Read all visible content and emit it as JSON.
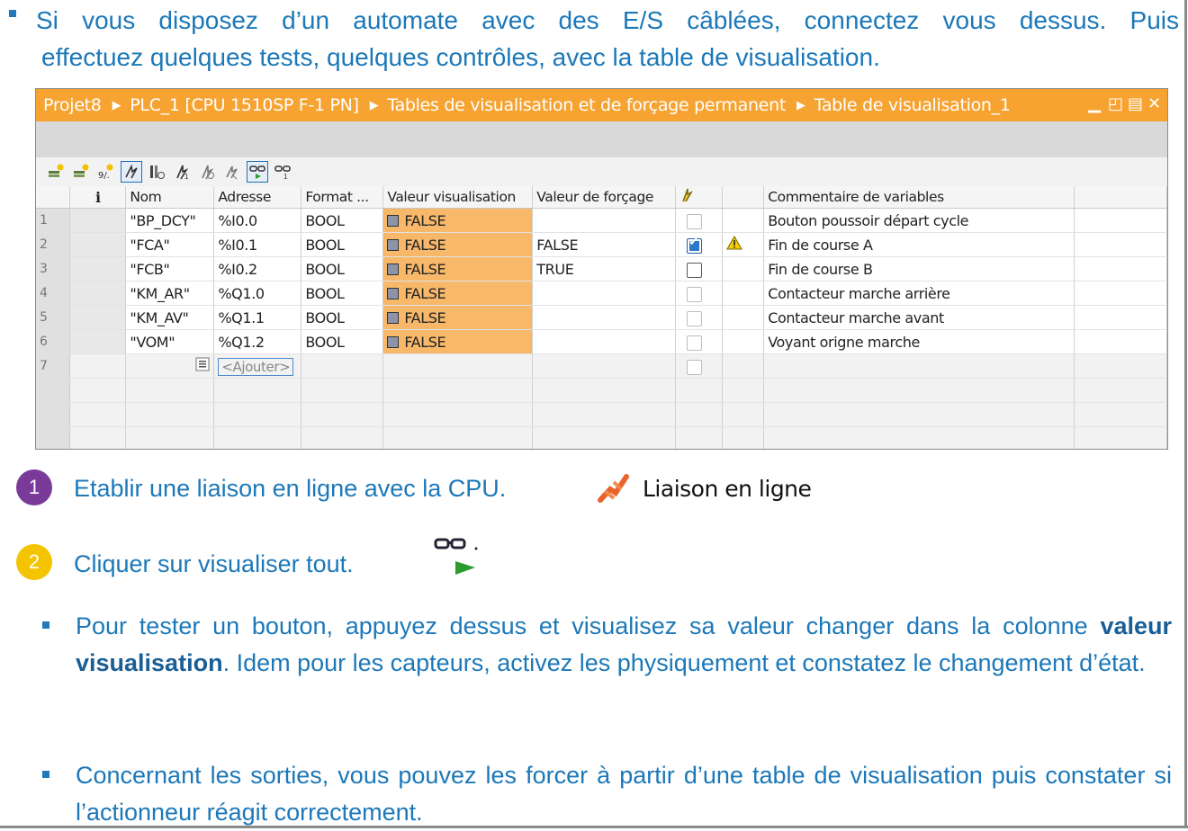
{
  "intro": {
    "line1": "Si vous disposez d’un automate avec des E/S câblées, connectez vous dessus. Puis",
    "line2": "effectuez quelques tests, quelques contrôles, avec la table de visualisation."
  },
  "window": {
    "breadcrumb": [
      "Projet8",
      "PLC_1 [CPU 1510SP F-1 PN]",
      "Tables de visualisation et de forçage permanent",
      "Table de visualisation_1"
    ],
    "title_bar_color": "#f7a331",
    "columns": [
      "",
      "i",
      "Nom",
      "Adresse",
      "Format ...",
      "Valeur visualisation",
      "Valeur de forçage",
      "",
      "",
      "Commentaire de variables"
    ],
    "rows": [
      {
        "num": "1",
        "nom": "\"BP_DCY\"",
        "adresse": "%I0.0",
        "format": "BOOL",
        "valeur": "FALSE",
        "forcage": "",
        "checked": false,
        "dark": false,
        "warn": false,
        "comment": "Bouton poussoir départ cycle"
      },
      {
        "num": "2",
        "nom": "\"FCA\"",
        "adresse": "%I0.1",
        "format": "BOOL",
        "valeur": "FALSE",
        "forcage": "FALSE",
        "checked": true,
        "dark": false,
        "warn": true,
        "comment": "Fin de course A"
      },
      {
        "num": "3",
        "nom": "\"FCB\"",
        "adresse": "%I0.2",
        "format": "BOOL",
        "valeur": "FALSE",
        "forcage": "TRUE",
        "checked": false,
        "dark": true,
        "warn": false,
        "comment": "Fin de course B"
      },
      {
        "num": "4",
        "nom": "\"KM_AR\"",
        "adresse": "%Q1.0",
        "format": "BOOL",
        "valeur": "FALSE",
        "forcage": "",
        "checked": false,
        "dark": false,
        "warn": false,
        "comment": "Contacteur marche arrière"
      },
      {
        "num": "5",
        "nom": "\"KM_AV\"",
        "adresse": "%Q1.1",
        "format": "BOOL",
        "valeur": "FALSE",
        "forcage": "",
        "checked": false,
        "dark": false,
        "warn": false,
        "comment": "Contacteur marche avant"
      },
      {
        "num": "6",
        "nom": "\"VOM\"",
        "adresse": "%Q1.2",
        "format": "BOOL",
        "valeur": "FALSE",
        "forcage": "",
        "checked": false,
        "dark": false,
        "warn": false,
        "comment": "Voyant origne marche"
      }
    ],
    "add_row": {
      "num": "7",
      "placeholder": "<Ajouter>"
    }
  },
  "steps": {
    "step1_num": "1",
    "step1_text": "Etablir une liaison en ligne avec la CPU.",
    "step1_button": "Liaison en ligne",
    "step2_num": "2",
    "step2_text": "Cliquer sur visualiser tout.",
    "step1_color": "#7a3a9a",
    "step2_color": "#f5c400"
  },
  "bullets": {
    "b1_pre": "Pour tester un bouton, appuyez dessus et visualisez sa valeur changer dans la colonne ",
    "b1_bold": "valeur visualisation",
    "b1_post": ". Idem pour les capteurs, activez les physiquement et constatez le changement d’état.",
    "b2": "Concernant les sorties, vous pouvez les forcer à partir d’une table de visualisation puis constater si l’actionneur réagit correctement."
  }
}
